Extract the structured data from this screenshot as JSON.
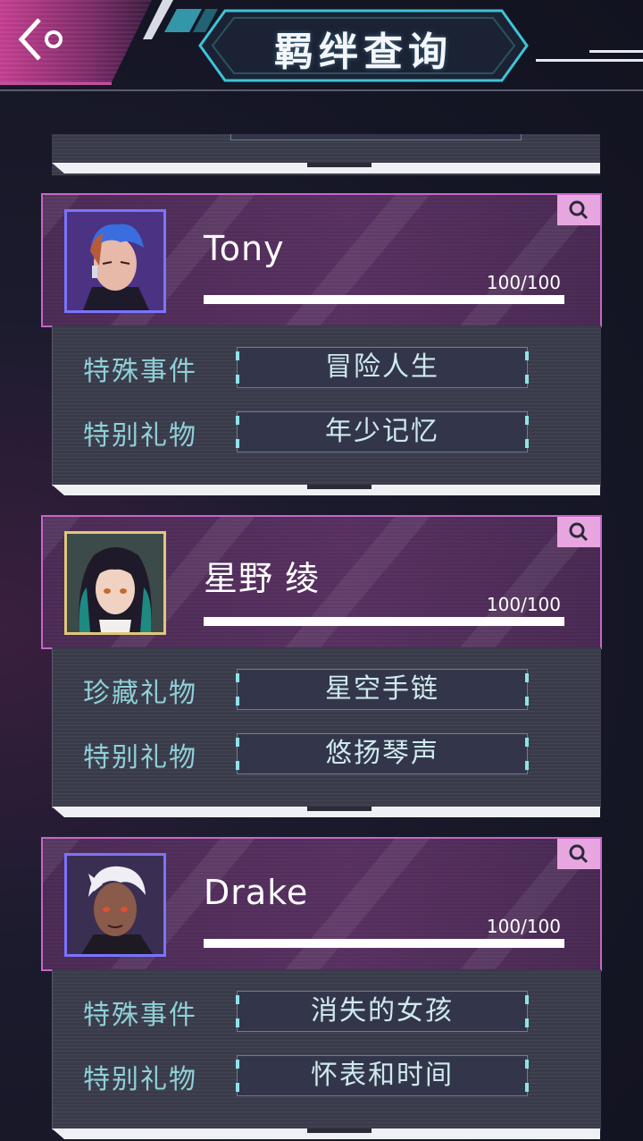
{
  "header": {
    "title": "羁绊查询",
    "back_icon": "chevron-left-icon"
  },
  "colors": {
    "card_border": "#c666c8",
    "label": "#8fd0d8",
    "search_tab": "#e8a6e0"
  },
  "characters": [
    {
      "name": "Tony",
      "progress_text": "100/100",
      "progress": 1.0,
      "rows": [
        {
          "label": "特殊事件",
          "value": "冒险人生"
        },
        {
          "label": "特别礼物",
          "value": "年少记忆"
        }
      ]
    },
    {
      "name": "星野 绫",
      "progress_text": "100/100",
      "progress": 1.0,
      "rows": [
        {
          "label": "珍藏礼物",
          "value": "星空手链"
        },
        {
          "label": "特别礼物",
          "value": "悠扬琴声"
        }
      ]
    },
    {
      "name": "Drake",
      "progress_text": "100/100",
      "progress": 1.0,
      "rows": [
        {
          "label": "特殊事件",
          "value": "消失的女孩"
        },
        {
          "label": "特别礼物",
          "value": "怀表和时间"
        }
      ]
    }
  ]
}
